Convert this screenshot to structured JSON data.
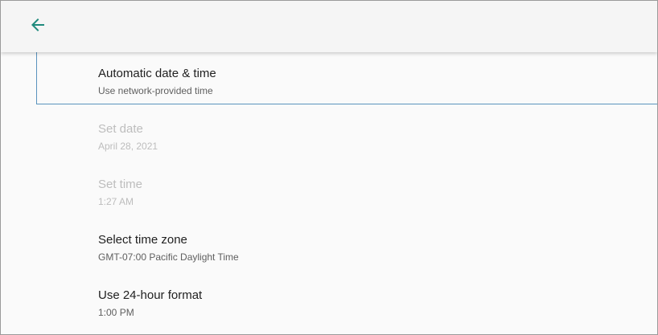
{
  "toolbar": {
    "back_icon": "arrow-back-icon",
    "accent_color": "#1f8a7d"
  },
  "settings": {
    "items": [
      {
        "title": "Automatic date & time",
        "summary": "Use network-provided time",
        "enabled": true,
        "focused": true
      },
      {
        "title": "Set date",
        "summary": "April 28, 2021",
        "enabled": false,
        "focused": false
      },
      {
        "title": "Set time",
        "summary": "1:27 AM",
        "enabled": false,
        "focused": false
      },
      {
        "title": "Select time zone",
        "summary": "GMT-07:00 Pacific Daylight Time",
        "enabled": true,
        "focused": false
      },
      {
        "title": "Use 24-hour format",
        "summary": "1:00 PM",
        "enabled": true,
        "focused": false
      }
    ]
  }
}
